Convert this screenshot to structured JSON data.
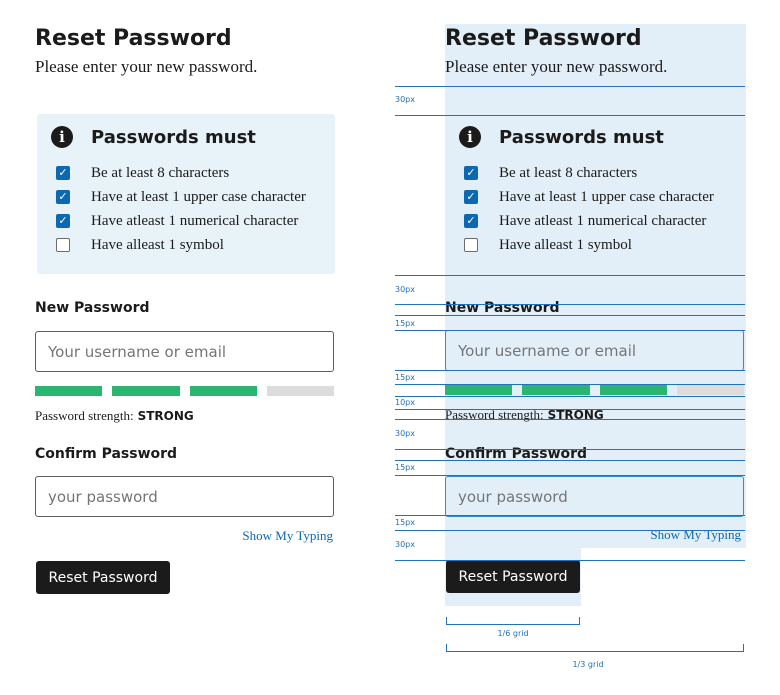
{
  "form": {
    "title": "Reset Password",
    "subtitle": "Please enter your new password.",
    "requirements": {
      "heading": "Passwords must",
      "info_icon": "info-icon",
      "items": [
        {
          "label": "Be at least 8 characters",
          "checked": true
        },
        {
          "label": "Have at least 1 upper case character",
          "checked": true
        },
        {
          "label": "Have atleast 1 numerical character",
          "checked": true
        },
        {
          "label": "Have alleast 1 symbol",
          "checked": false
        }
      ]
    },
    "new_password": {
      "label": "New Password",
      "placeholder": "Your username or email"
    },
    "strength": {
      "label": "Password strength:",
      "value": "STRONG",
      "filled_segments": 3,
      "total_segments": 4
    },
    "confirm_password": {
      "label": "Confirm Password",
      "placeholder": "your password"
    },
    "show_typing": "Show My Typing",
    "submit_label": "Reset Password"
  },
  "annotations": {
    "gaps": [
      "30px",
      "30px",
      "15px",
      "15px",
      "10px",
      "30px",
      "15px",
      "15px",
      "30px"
    ],
    "grid_short": "1/6 grid",
    "grid_long": "1/3 grid"
  },
  "colors": {
    "accent": "#0c68b0",
    "strength_fill": "#2cb571",
    "strength_empty": "#dcdcdc",
    "requirements_bg": "#e7f2f9",
    "annotation": "#2272b5",
    "button_bg": "#1b1b1b"
  }
}
